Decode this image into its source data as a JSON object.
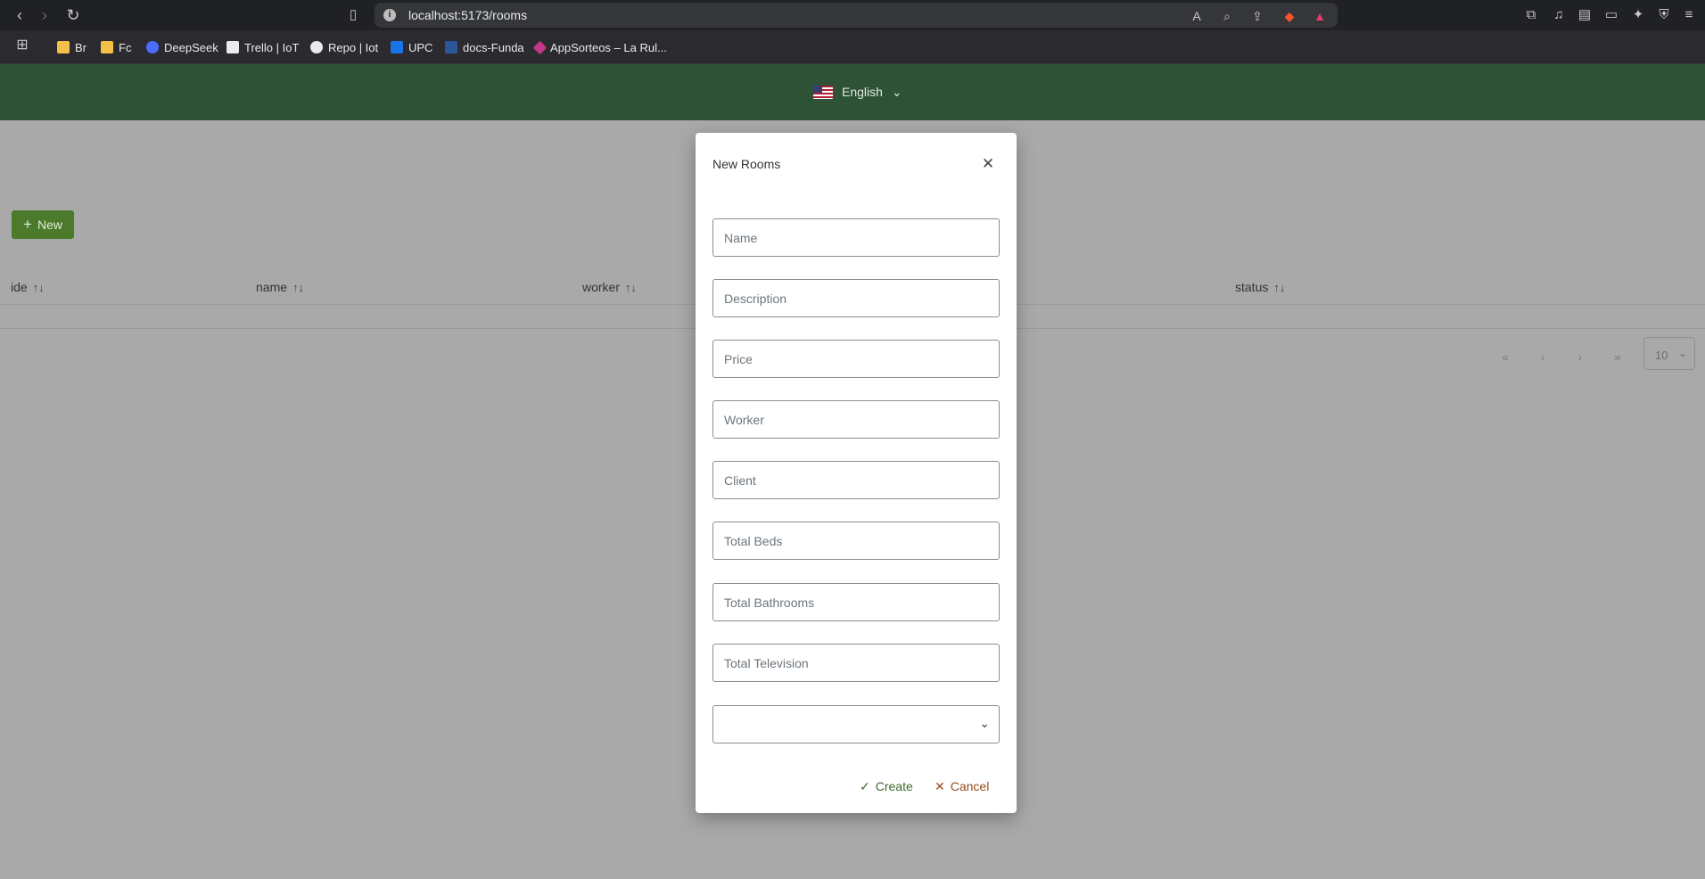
{
  "browser": {
    "url": "localhost:5173/rooms",
    "bookmarks": [
      {
        "label": "Br"
      },
      {
        "label": "Fc"
      },
      {
        "label": "DeepSeek"
      },
      {
        "label": "Trello | IoT"
      },
      {
        "label": "Repo | Iot"
      },
      {
        "label": "UPC"
      },
      {
        "label": "docs-Funda"
      },
      {
        "label": "AppSorteos – La Rul..."
      }
    ]
  },
  "header": {
    "language": "English"
  },
  "toolbar": {
    "new_label": "New"
  },
  "table": {
    "columns": [
      "ide",
      "name",
      "worker",
      "status"
    ]
  },
  "pagination": {
    "rows_per_page": "10"
  },
  "dialog": {
    "title": "New Rooms",
    "fields": {
      "name": "Name",
      "description": "Description",
      "price": "Price",
      "worker": "Worker",
      "client": "Client",
      "total_beds": "Total Beds",
      "total_bathrooms": "Total Bathrooms",
      "total_television": "Total Television"
    },
    "create_label": "Create",
    "cancel_label": "Cancel"
  },
  "colors": {
    "header_green": "#2e5236",
    "button_green": "#4b7a2b",
    "overlay_gray": "#a9a9a9",
    "cancel_color": "#9a4a1a"
  }
}
